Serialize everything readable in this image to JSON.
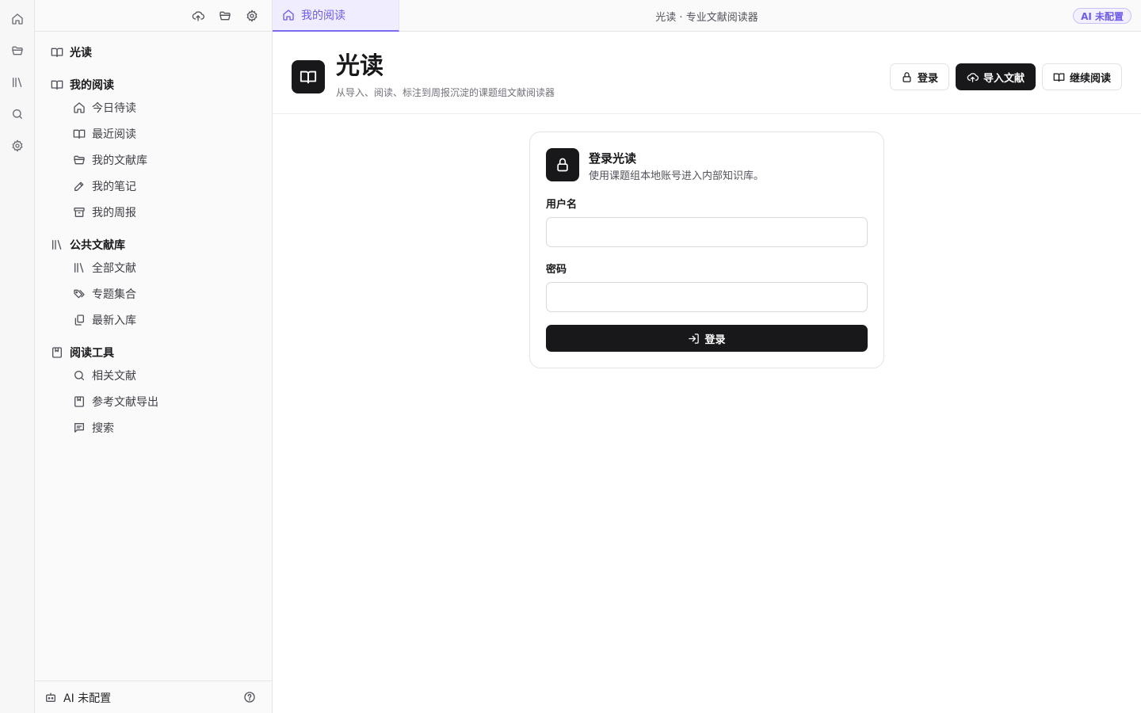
{
  "rail": {
    "items": [
      {
        "icon": "home-icon"
      },
      {
        "icon": "folder-icon"
      },
      {
        "icon": "library-icon"
      },
      {
        "icon": "search-icon"
      },
      {
        "icon": "gear-icon"
      }
    ]
  },
  "sidebar": {
    "toolbar": {
      "icons": [
        "upload-icon",
        "folder-open-icon",
        "gear-icon"
      ]
    },
    "brand": "光读",
    "sections": [
      {
        "title": "我的阅读",
        "items": [
          "今日待读",
          "最近阅读",
          "我的文献库",
          "我的笔记",
          "我的周报"
        ]
      },
      {
        "title": "公共文献库",
        "items": [
          "全部文献",
          "专题集合",
          "最新入库"
        ]
      },
      {
        "title": "阅读工具",
        "items": [
          "相关文献",
          "参考文献导出",
          "搜索"
        ]
      }
    ],
    "footer": {
      "ai_status": "AI 未配置"
    }
  },
  "topbar": {
    "active_tab": "我的阅读",
    "window_title": "光读 · 专业文献阅读器",
    "ai_badge": "AI 未配置"
  },
  "header": {
    "title": "光读",
    "subtitle": "从导入、阅读、标注到周报沉淀的课题组文献阅读器",
    "buttons": {
      "login": "登录",
      "import": "导入文献",
      "continue": "继续阅读"
    }
  },
  "login_card": {
    "title": "登录光读",
    "description": "使用课题组本地账号进入内部知识库。",
    "username_label": "用户名",
    "username_value": "",
    "password_label": "密码",
    "password_value": "",
    "submit": "登录"
  },
  "colors": {
    "accent": "#6d5ce7",
    "accent_bg": "#efedff",
    "dark": "#18181b"
  }
}
